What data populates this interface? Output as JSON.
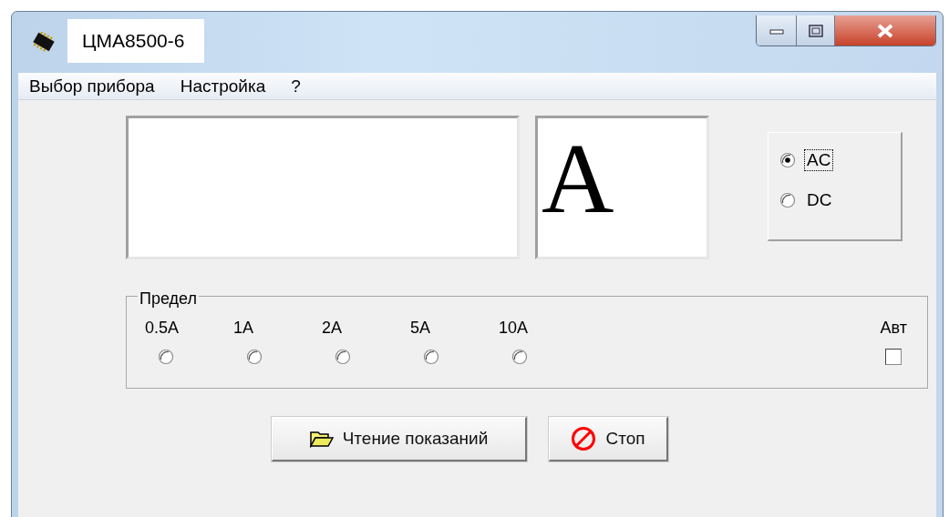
{
  "window": {
    "title": "ЦМА8500-6"
  },
  "menu": [
    {
      "label": "Выбор прибора"
    },
    {
      "label": "Настройка"
    },
    {
      "label": "?"
    }
  ],
  "display": {
    "unit": "A"
  },
  "mode": [
    {
      "label": "AC",
      "selected": true,
      "focused": true
    },
    {
      "label": "DC",
      "selected": false,
      "focused": false
    }
  ],
  "range": {
    "title": "Предел",
    "options": [
      {
        "label": "0.5A",
        "selected": false
      },
      {
        "label": "1A",
        "selected": false
      },
      {
        "label": "2A",
        "selected": false
      },
      {
        "label": "5A",
        "selected": false
      },
      {
        "label": "10A",
        "selected": false
      }
    ],
    "auto": {
      "label": "Авт",
      "checked": false
    }
  },
  "buttons": [
    {
      "label": "Чтение показаний",
      "kind": "read"
    },
    {
      "label": "Стоп",
      "kind": "stop"
    }
  ]
}
